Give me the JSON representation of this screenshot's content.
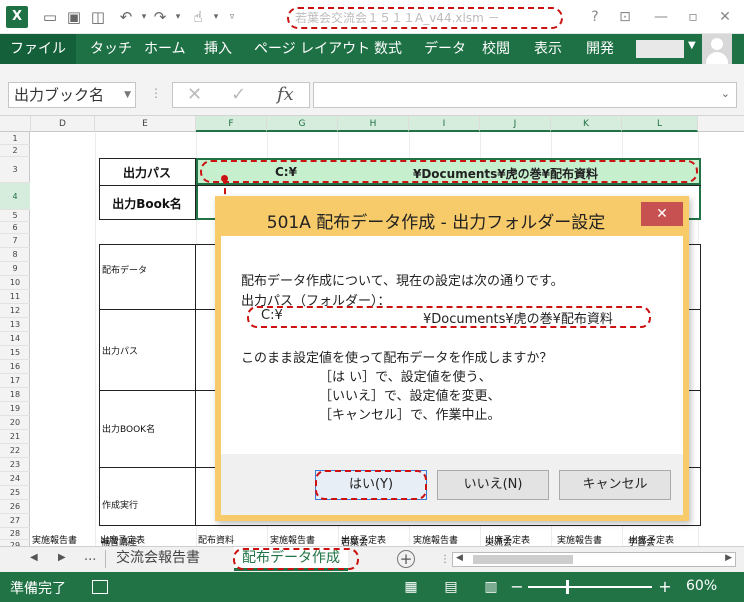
{
  "window": {
    "filename": "若葉会交流会１５１１A_v44.xlsm －",
    "help": "?",
    "minimize": "—",
    "close": "✕"
  },
  "ribbon": {
    "file": "ファイル",
    "tabs": [
      "タッチ",
      "ホーム",
      "挿入",
      "ページ レイアウト",
      "数式",
      "データ",
      "校閲",
      "表示",
      "開発"
    ]
  },
  "formula_bar": {
    "name_box": "出力ブック名",
    "cancel": "✕",
    "enter": "✓",
    "fx": "fx",
    "value": ""
  },
  "columns": [
    "D",
    "E",
    "F",
    "G",
    "H",
    "I",
    "J",
    "K",
    "L"
  ],
  "rows": [
    "1",
    "2",
    "3",
    "4",
    "5",
    "6",
    "7",
    "8",
    "9",
    "10",
    "11",
    "12",
    "13",
    "14",
    "15",
    "16",
    "17",
    "18",
    "19",
    "20",
    "21",
    "22",
    "23",
    "24",
    "25",
    "26",
    "27",
    "28",
    "29"
  ],
  "sheet": {
    "output_path_label": "出力パス",
    "output_path_drive": "C:¥",
    "output_path_tail": "¥Documents¥虎の巻¥配布資料",
    "output_book_label": "出力Book名",
    "section_labels": [
      "配布データ",
      "出力パス",
      "出力BOOK名",
      "作成実行"
    ],
    "row28": [
      "補習講座",
      "若葉会",
      "交流会",
      "学習会"
    ],
    "row29": [
      "実施報告書",
      "出席予定表",
      "配布資料",
      "実施報告書",
      "出席予定表",
      "実施報告書",
      "出席予定表",
      "実施報告書",
      "出席予定表"
    ]
  },
  "sheet_tabs": {
    "ellipsis": "...",
    "tabs": [
      "交流会報告書",
      "配布データ作成"
    ],
    "add": "+"
  },
  "status": {
    "ready": "準備完了",
    "zoom": "60%",
    "zoom_minus": "−",
    "zoom_plus": "+"
  },
  "dialog": {
    "title": "501A 配布データ作成 - 出力フォルダー設定",
    "line1": "配布データ作成について、現在の設定は次の通りです。",
    "line2": "出力パス（フォルダー）：",
    "path_drive": "C:¥",
    "path_tail": "¥Documents¥虎の巻¥配布資料",
    "question": "このまま設定値を使って配布データを作成しますか？",
    "opt_yes": "［は い］で、設定値を使う、",
    "opt_no": "［いいえ］で、設定値を変更、",
    "opt_cancel": "［キャンセル］で、作業中止。",
    "buttons": [
      "はい(Y)",
      "いいえ(N)",
      "キャンセル"
    ]
  }
}
